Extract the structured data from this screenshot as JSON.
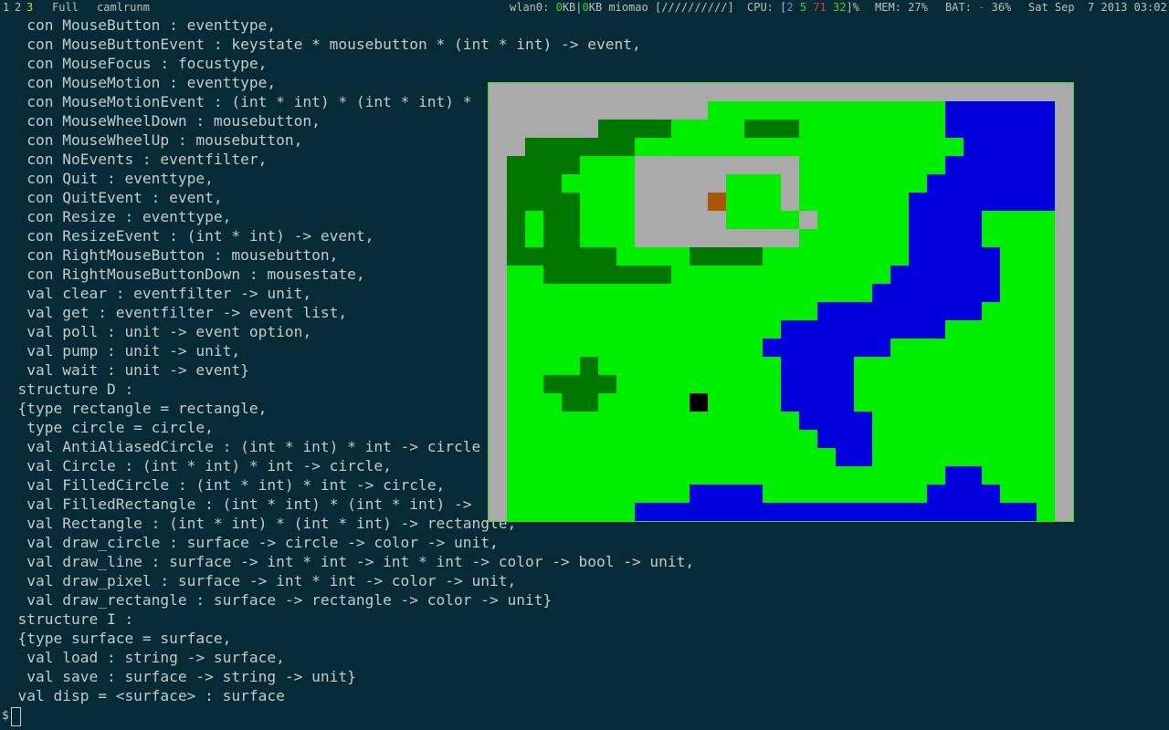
{
  "statusbar": {
    "tags": [
      "1",
      "2",
      "3"
    ],
    "active_tag": "3",
    "layout": "Full",
    "window_title": "camlrunm",
    "net_prefix": "wlan0: ",
    "net_down": "0",
    "net_mid": "KB|",
    "net_up": "0",
    "net_suffix": "KB miomao [//////////]",
    "cpu_prefix": "CPU: [",
    "cpu_vals": [
      "2",
      "5",
      "71",
      "32"
    ],
    "cpu_suffix": "]%",
    "mem": "MEM: 27%",
    "bat_prefix": "BAT: ",
    "bat_sign": "-",
    "bat_value": "36%",
    "datetime": "Sat Sep  7 2013 03:02"
  },
  "terminal": {
    "lines": [
      "   con MouseButton : eventtype,",
      "   con MouseButtonEvent : keystate * mousebutton * (int * int) -> event,",
      "   con MouseFocus : focustype,",
      "   con MouseMotion : eventtype,",
      "   con MouseMotionEvent : (int * int) * (int * int) * ",
      "   con MouseWheelDown : mousebutton,",
      "   con MouseWheelUp : mousebutton,",
      "   con NoEvents : eventfilter,",
      "   con Quit : eventtype,",
      "   con QuitEvent : event,",
      "   con Resize : eventtype,",
      "   con ResizeEvent : (int * int) -> event,",
      "   con RightMouseButton : mousebutton,",
      "   con RightMouseButtonDown : mousestate,",
      "   val clear : eventfilter -> unit,",
      "   val get : eventfilter -> event list,",
      "   val poll : unit -> event option,",
      "   val pump : unit -> unit,",
      "   val wait : unit -> event}",
      "  structure D :",
      "  {type rectangle = rectangle,",
      "   type circle = circle,",
      "   val AntiAliasedCircle : (int * int) * int -> circle",
      "   val Circle : (int * int) * int -> circle,",
      "   val FilledCircle : (int * int) * int -> circle,",
      "   val FilledRectangle : (int * int) * (int * int) -> ",
      "   val Rectangle : (int * int) * (int * int) -> rectangle,",
      "   val draw_circle : surface -> circle -> color -> unit,",
      "   val draw_line : surface -> int * int -> int * int -> color -> bool -> unit,",
      "   val draw_pixel : surface -> int * int -> color -> unit,",
      "   val draw_rectangle : surface -> rectangle -> color -> unit}",
      "  structure I :",
      "  {type surface = surface,",
      "   val load : string -> surface,",
      "   val save : surface -> string -> unit}",
      "  val disp = <surface> : surface"
    ],
    "prompt": "$"
  },
  "sdl_map": {
    "palette": {
      "G": "#00ee00",
      "D": "#007700",
      "B": "#0000dd",
      "R": "#aaaaaa",
      "M": "#aa5500",
      "K": "#000000"
    },
    "rows": [
      "RRRRRRRRRRRGGGGGGGGGGGGGBBBBBB",
      "RRRRRDDDDGGGGDDDGGGGGGGGBBBBBB",
      "RDDDDDDGGGGGGGGGGGGGGGGGGBBBBB",
      "DDDDGGGRRRRRRRRRGGGGGGGGBBBBBB",
      "DDDGGGGRRRRRGGGRGGGGGGGBBBBBBB",
      "DDDDGGGRRRRMGGGRGGGGGGBBBBBBBB",
      "DGDDGGGRRRRRGGGGRGGGGGBBBBGGGG",
      "DGDDGGGRRRRRRRRRGGGGGGBBBBGGGG",
      "DDDDDDGGGGDDDDGGGGGGGGBBBBBGGG",
      "GGDDDDDDDGGGGGGGGGGGGBBBBBBGGG",
      "GGGGGGGGGGGGGGGGGGGGBBBBBBBGGG",
      "GGGGGGGGGGGGGGGGGBBBBBBBBBGGGG",
      "GGGGGGGGGGGGGGGBBBBBBBBBGGGGGG",
      "GGGGGGGGGGGGGGBBBBBBBGGGGGGGGG",
      "GGGGDGGGGGGGGGGBBBBGGGGGGGGGGG",
      "GGDDDDGGGGGGGGGBBBBGGGGGGGGGGG",
      "GGGDDGGGGGKGGGGBBBBGGGGGGGGGGG",
      "GGGGGGGGGGGGGGGGBBBBGGGGGGGGGG",
      "GGGGGGGGGGGGGGGGGBBBGGGGGGGGGG",
      "GGGGGGGGGGGGGGGGGGBBGGGGGGGGGG",
      "GGGGGGGGGGGGGGGGGGGGGGGGBBGGGG",
      "GGGGGGGGGGBBBBGGGGGGGGGBBBBGGG",
      "GGGGGGGBBBBBBBBBBBBBBBBBBBBBBG"
    ]
  }
}
